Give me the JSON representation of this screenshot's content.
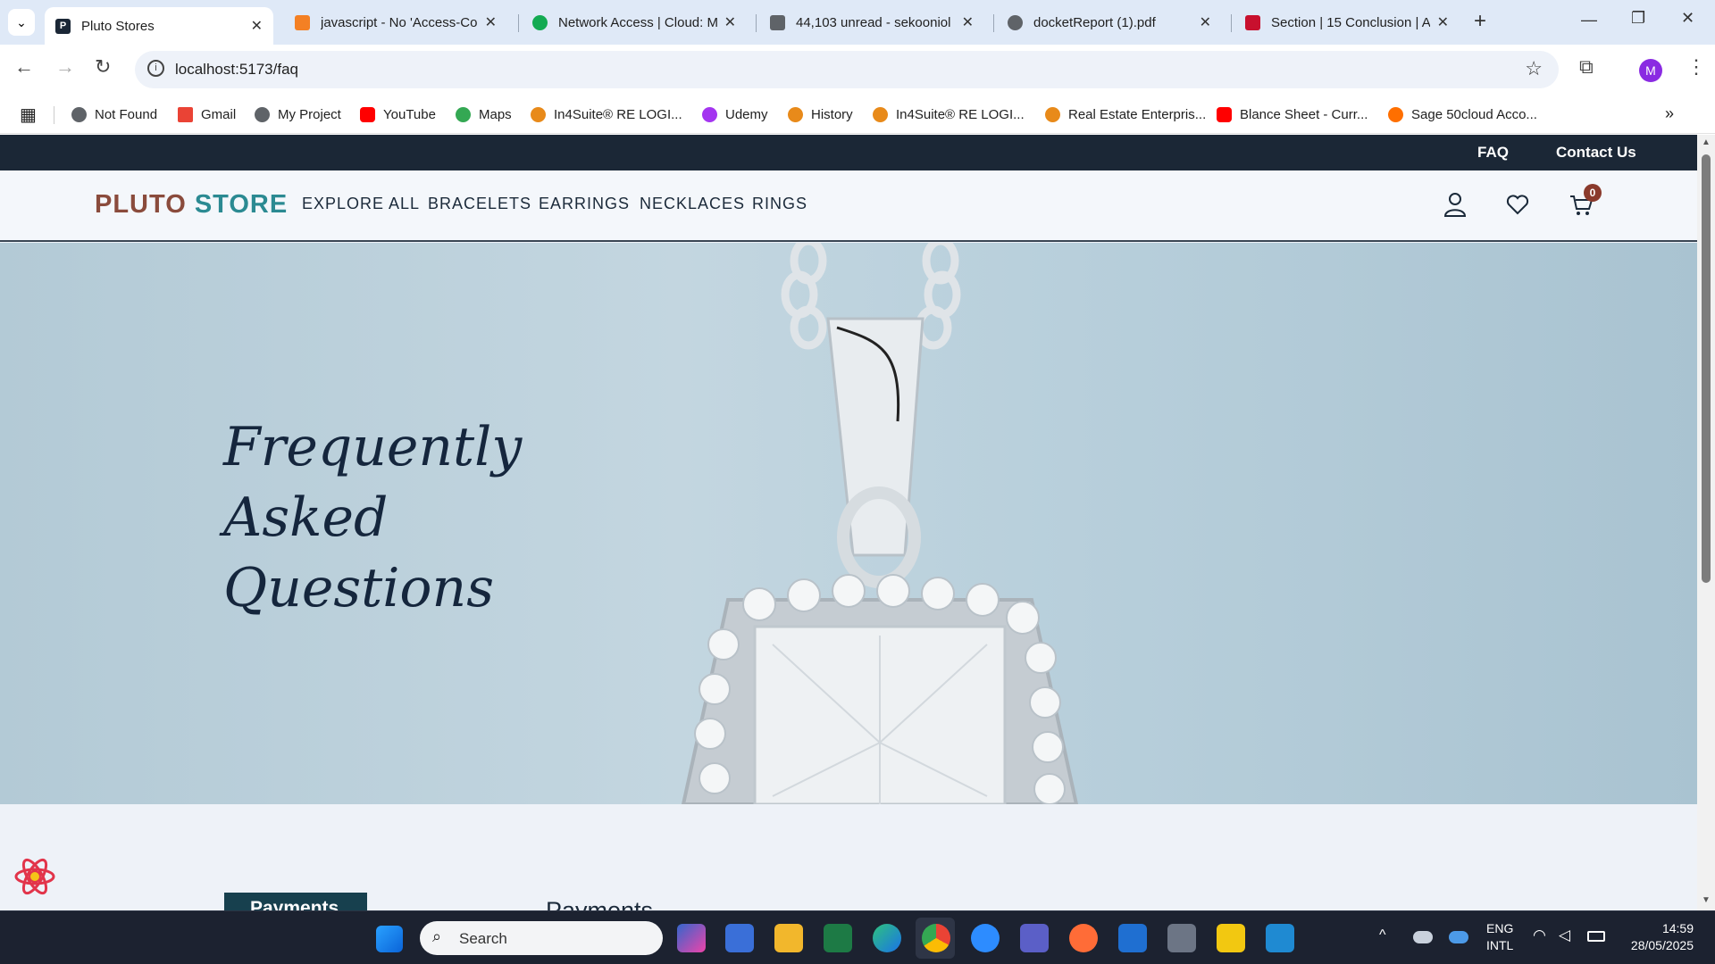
{
  "browser": {
    "tabs": [
      {
        "title": "Pluto Stores",
        "active": true,
        "favicon": "pluto-p-icon",
        "color": "#1b2736"
      },
      {
        "title": "javascript - No 'Access-Cor",
        "favicon": "stackoverflow-icon",
        "color": "#f48024"
      },
      {
        "title": "Network Access | Cloud: M",
        "favicon": "mongodb-leaf-icon",
        "color": "#13aa52"
      },
      {
        "title": "44,103 unread - sekooniol",
        "favicon": "mail-icon",
        "color": "#5f6368"
      },
      {
        "title": "docketReport (1).pdf",
        "favicon": "globe-icon",
        "color": "#5f6368"
      },
      {
        "title": "Section | 15 Conclusion | A",
        "favicon": "acca-icon",
        "color": "#c8102e"
      }
    ],
    "url": "localhost:5173/faq",
    "profile_initial": "M",
    "bookmarks": [
      {
        "label": "Not Found",
        "icon": "globe-icon",
        "color": "#5f6368"
      },
      {
        "label": "Gmail",
        "icon": "gmail-icon",
        "color": "#ea4335"
      },
      {
        "label": "My Project",
        "icon": "globe-icon",
        "color": "#5f6368"
      },
      {
        "label": "YouTube",
        "icon": "youtube-icon",
        "color": "#ff0000"
      },
      {
        "label": "Maps",
        "icon": "maps-icon",
        "color": "#34a853"
      },
      {
        "label": "In4Suite® RE LOGI...",
        "icon": "in4suite-icon",
        "color": "#e88a1a"
      },
      {
        "label": "Udemy",
        "icon": "udemy-icon",
        "color": "#a435f0"
      },
      {
        "label": "History",
        "icon": "history-icon",
        "color": "#e88a1a"
      },
      {
        "label": "In4Suite® RE LOGI...",
        "icon": "in4suite-icon",
        "color": "#e88a1a"
      },
      {
        "label": "Real Estate Enterpris...",
        "icon": "in4suite-icon",
        "color": "#e88a1a"
      },
      {
        "label": "Blance Sheet - Curr...",
        "icon": "youtube-icon",
        "color": "#ff0000"
      },
      {
        "label": "Sage 50cloud Acco...",
        "icon": "sage-icon",
        "color": "#ff6f00"
      }
    ]
  },
  "site": {
    "top_links": [
      "FAQ",
      "Contact Us"
    ],
    "logo": {
      "part1": "PLUTO",
      "part2": "STORE",
      "color1": "#8a4b3c",
      "color2": "#2b8a92"
    },
    "nav": [
      "EXPLORE ALL",
      "BRACELETS",
      "EARRINGS",
      "NECKLACES",
      "RINGS"
    ],
    "cart_count": "0",
    "hero_title": [
      "Frequently",
      "Asked",
      "Questions"
    ],
    "faq_tab": "Payments",
    "faq_heading": "Payments"
  },
  "taskbar": {
    "search_placeholder": "Search",
    "lang": "ENG",
    "layout": "INTL",
    "time": "14:59",
    "date": "28/05/2025"
  }
}
